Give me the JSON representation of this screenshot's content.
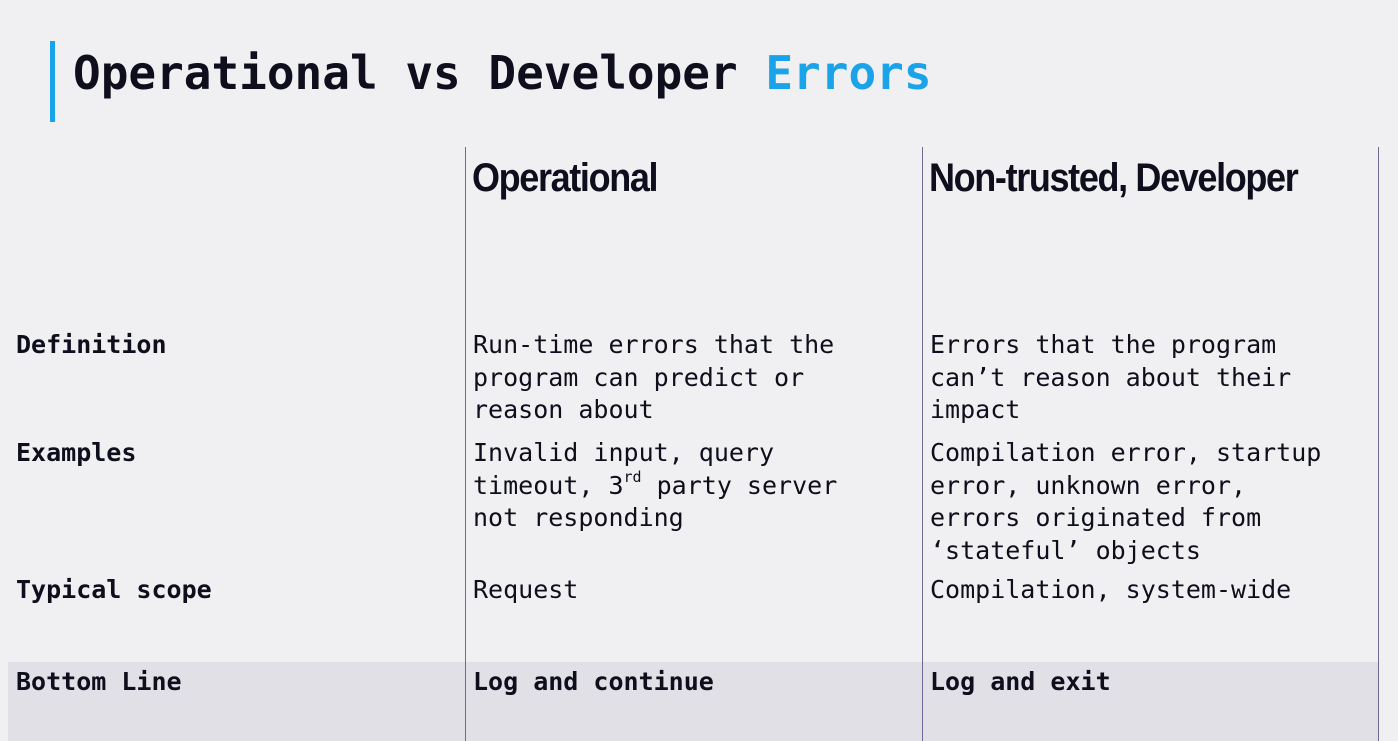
{
  "slide": {
    "title_main": "Operational vs Developer ",
    "title_accent": "Errors",
    "accent_color": "#1aa3e8"
  },
  "columns": {
    "operational": "Operational",
    "developer": "Non-trusted, Developer"
  },
  "rows": {
    "definition": {
      "label": "Definition",
      "operational": "Run-time errors that the\nprogram can predict or\nreason about",
      "developer": "Errors that the program\ncan’t reason about their\nimpact"
    },
    "examples": {
      "label": "Examples",
      "operational_line1": "Invalid input, query",
      "operational_line2_a": "timeout, 3",
      "operational_line2_sup": "rd",
      "operational_line2_b": " party server",
      "operational_line3": "not responding",
      "developer": "Compilation error, startup\nerror, unknown error,\nerrors originated from\n‘stateful’ objects"
    },
    "scope": {
      "label": "Typical scope",
      "operational": "Request",
      "developer": "Compilation, system-wide"
    },
    "bottom_line": {
      "label": "Bottom Line",
      "operational": "Log and continue",
      "developer": "Log and exit"
    }
  }
}
